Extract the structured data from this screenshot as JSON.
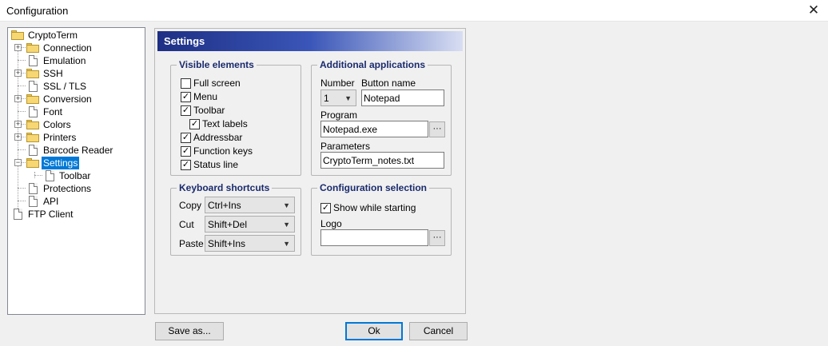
{
  "window": {
    "title": "Configuration",
    "close_glyph": "✕"
  },
  "tree": {
    "items": [
      {
        "label": "CryptoTerm",
        "icon": "folder-open-icon"
      },
      {
        "label": "Connection",
        "icon": "folder-icon"
      },
      {
        "label": "Emulation",
        "icon": "document-icon"
      },
      {
        "label": "SSH",
        "icon": "folder-icon"
      },
      {
        "label": "SSL / TLS",
        "icon": "document-icon"
      },
      {
        "label": "Conversion",
        "icon": "folder-icon"
      },
      {
        "label": "Font",
        "icon": "document-icon"
      },
      {
        "label": "Colors",
        "icon": "folder-icon"
      },
      {
        "label": "Printers",
        "icon": "folder-icon"
      },
      {
        "label": "Barcode Reader",
        "icon": "document-icon"
      },
      {
        "label": "Settings",
        "icon": "folder-open-icon",
        "selected": true
      },
      {
        "label": "Toolbar",
        "icon": "document-icon"
      },
      {
        "label": "Protections",
        "icon": "document-icon"
      },
      {
        "label": "API",
        "icon": "document-icon"
      },
      {
        "label": "FTP Client",
        "icon": "document-icon"
      }
    ]
  },
  "panel": {
    "banner": "Settings",
    "visible_elements": {
      "title": "Visible elements",
      "items": [
        {
          "label": "Full screen",
          "checked": false
        },
        {
          "label": "Menu",
          "checked": true
        },
        {
          "label": "Toolbar",
          "checked": true
        },
        {
          "label": "Text labels",
          "checked": true
        },
        {
          "label": "Addressbar",
          "checked": true
        },
        {
          "label": "Function keys",
          "checked": true
        },
        {
          "label": "Status line",
          "checked": true
        }
      ]
    },
    "additional_apps": {
      "title": "Additional applications",
      "number_label": "Number",
      "number_value": "1",
      "button_name_label": "Button name",
      "button_name_value": "Notepad",
      "program_label": "Program",
      "program_value": "Notepad.exe",
      "parameters_label": "Parameters",
      "parameters_value": "CryptoTerm_notes.txt",
      "browse_glyph": "···"
    },
    "keyboard_shortcuts": {
      "title": "Keyboard shortcuts",
      "rows": [
        {
          "label": "Copy",
          "value": "Ctrl+Ins"
        },
        {
          "label": "Cut",
          "value": "Shift+Del"
        },
        {
          "label": "Paste",
          "value": "Shift+Ins"
        }
      ]
    },
    "config_selection": {
      "title": "Configuration selection",
      "show_label": "Show while starting",
      "show_checked": true,
      "logo_label": "Logo",
      "logo_value": "",
      "browse_glyph": "···"
    }
  },
  "buttons": {
    "save_as": "Save as...",
    "ok": "Ok",
    "cancel": "Cancel"
  },
  "glyphs": {
    "check": "✓",
    "combo_arrow": "▼",
    "expand": "+",
    "collapse": "−"
  }
}
